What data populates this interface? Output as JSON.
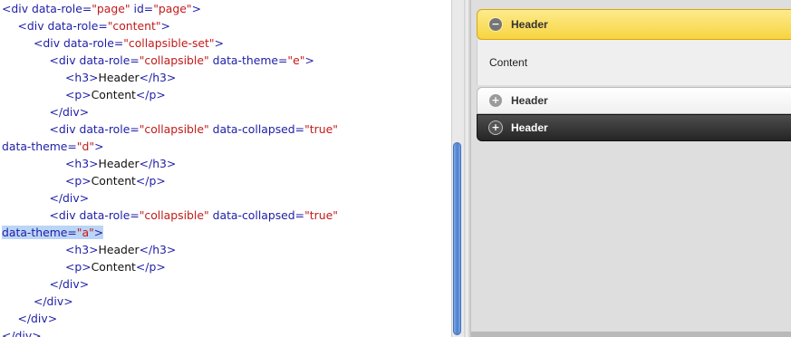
{
  "editor": {
    "lines": [
      {
        "indent": 0,
        "parts": [
          [
            "tag",
            "<div "
          ],
          [
            "attr",
            "data-role="
          ],
          [
            "val",
            "\"page\""
          ],
          [
            "attr",
            " id="
          ],
          [
            "val",
            "\"page\""
          ],
          [
            "tag",
            ">"
          ]
        ]
      },
      {
        "indent": 1,
        "parts": [
          [
            "tag",
            "<div "
          ],
          [
            "attr",
            "data-role="
          ],
          [
            "val",
            "\"content\""
          ],
          [
            "tag",
            ">"
          ]
        ]
      },
      {
        "indent": 2,
        "parts": [
          [
            "tag",
            "<div "
          ],
          [
            "attr",
            "data-role="
          ],
          [
            "val",
            "\"collapsible-set\""
          ],
          [
            "tag",
            ">"
          ]
        ]
      },
      {
        "indent": 3,
        "parts": [
          [
            "tag",
            "<div "
          ],
          [
            "attr",
            "data-role="
          ],
          [
            "val",
            "\"collapsible\""
          ],
          [
            "attr",
            " data-theme="
          ],
          [
            "val",
            "\"e\""
          ],
          [
            "tag",
            ">"
          ]
        ]
      },
      {
        "indent": 4,
        "parts": [
          [
            "tag",
            "<h3>"
          ],
          [
            "txt",
            "Header"
          ],
          [
            "tag",
            "</h3>"
          ]
        ]
      },
      {
        "indent": 4,
        "parts": [
          [
            "tag",
            "<p>"
          ],
          [
            "txt",
            "Content"
          ],
          [
            "tag",
            "</p>"
          ]
        ]
      },
      {
        "indent": 3,
        "parts": [
          [
            "tag",
            "</div>"
          ]
        ]
      },
      {
        "indent": 3,
        "parts": [
          [
            "tag",
            "<div "
          ],
          [
            "attr",
            "data-role="
          ],
          [
            "val",
            "\"collapsible\""
          ],
          [
            "attr",
            " data-collapsed="
          ],
          [
            "val",
            "\"true\""
          ]
        ]
      },
      {
        "indent": 0,
        "parts": [
          [
            "attr",
            "data-theme="
          ],
          [
            "val",
            "\"d\""
          ],
          [
            "tag",
            ">"
          ]
        ]
      },
      {
        "indent": 4,
        "parts": [
          [
            "tag",
            "<h3>"
          ],
          [
            "txt",
            "Header"
          ],
          [
            "tag",
            "</h3>"
          ]
        ]
      },
      {
        "indent": 4,
        "parts": [
          [
            "tag",
            "<p>"
          ],
          [
            "txt",
            "Content"
          ],
          [
            "tag",
            "</p>"
          ]
        ]
      },
      {
        "indent": 3,
        "parts": [
          [
            "tag",
            "</div>"
          ]
        ]
      },
      {
        "indent": 3,
        "parts": [
          [
            "tag",
            "<div "
          ],
          [
            "attr",
            "data-role="
          ],
          [
            "val",
            "\"collapsible\""
          ],
          [
            "attr",
            " data-collapsed="
          ],
          [
            "val",
            "\"true\""
          ]
        ]
      },
      {
        "indent": 0,
        "selected": true,
        "parts": [
          [
            "attr",
            "data-theme="
          ],
          [
            "val",
            "\"a\""
          ],
          [
            "tag",
            ">"
          ]
        ]
      },
      {
        "indent": 4,
        "parts": [
          [
            "tag",
            "<h3>"
          ],
          [
            "txt",
            "Header"
          ],
          [
            "tag",
            "</h3>"
          ]
        ]
      },
      {
        "indent": 4,
        "parts": [
          [
            "tag",
            "<p>"
          ],
          [
            "txt",
            "Content"
          ],
          [
            "tag",
            "</p>"
          ]
        ]
      },
      {
        "indent": 3,
        "parts": [
          [
            "tag",
            "</div>"
          ]
        ]
      },
      {
        "indent": 2,
        "parts": [
          [
            "tag",
            "</div>"
          ]
        ]
      },
      {
        "indent": 1,
        "parts": [
          [
            "tag",
            "</div>"
          ]
        ]
      },
      {
        "indent": 0,
        "parts": [
          [
            "tag",
            "</div>"
          ]
        ]
      }
    ]
  },
  "preview": {
    "collapsibles": [
      {
        "theme": "e",
        "header": "Header",
        "icon": "minus-icon",
        "icon_glyph": "−",
        "content": "Content",
        "expanded": true
      },
      {
        "theme": "d",
        "header": "Header",
        "icon": "plus-icon",
        "icon_glyph": "+",
        "expanded": false
      },
      {
        "theme": "a",
        "header": "Header",
        "icon": "plus-icon",
        "icon_glyph": "+",
        "expanded": false
      }
    ]
  },
  "colors": {
    "tag": "#1e1ea8",
    "value": "#c21a1a",
    "selection": "#bcd5f6",
    "theme_e": "#f7d441",
    "theme_a": "#333333"
  }
}
